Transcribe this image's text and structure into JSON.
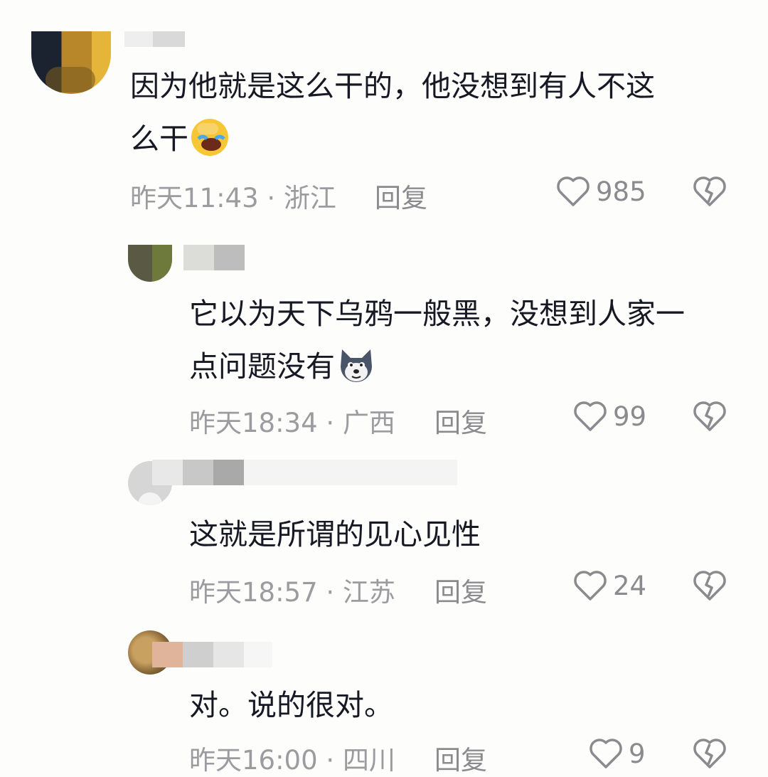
{
  "comments": [
    {
      "text_lines": [
        "因为他就是这么干的，他没想到有人不这",
        "么干"
      ],
      "emoji": "facepalm-laugh-emoji",
      "time": "昨天11:43",
      "location": "浙江",
      "reply_label": "回复",
      "likes": "985",
      "avatar_colors": [
        "#1c2330",
        "#b8872a",
        "#e5b53a",
        "#7a5a20"
      ]
    },
    {
      "text_lines": [
        "它以为天下乌鸦一般黑，没想到人家一",
        "点问题没有"
      ],
      "emoji": "husky-dog-emoji",
      "time": "昨天18:34",
      "location": "广西",
      "reply_label": "回复",
      "likes": "99",
      "avatar_colors": [
        "#5a5a44",
        "#6e7a3c",
        "#dcdcd8",
        "#bdbdbd"
      ]
    },
    {
      "text_lines": [
        "这就是所谓的见心见性"
      ],
      "time": "昨天18:57",
      "location": "江苏",
      "reply_label": "回复",
      "likes": "24",
      "avatar_colors": [
        "#d6d6d6",
        "#e8e8e8",
        "#c8c8c8",
        "#a9a9a9"
      ]
    },
    {
      "text_lines": [
        "对。说的很对。"
      ],
      "time": "昨天16:00",
      "location": "四川",
      "reply_label": "回复",
      "likes": "9",
      "avatar_colors": [
        "#8a6a3a",
        "#e0b49a",
        "#cfcfcf",
        "#e6e6e6"
      ]
    }
  ],
  "separator": " · ",
  "colors": {
    "text": "#161823",
    "meta": "#9b9ba0",
    "background": "#fdfdfb"
  }
}
